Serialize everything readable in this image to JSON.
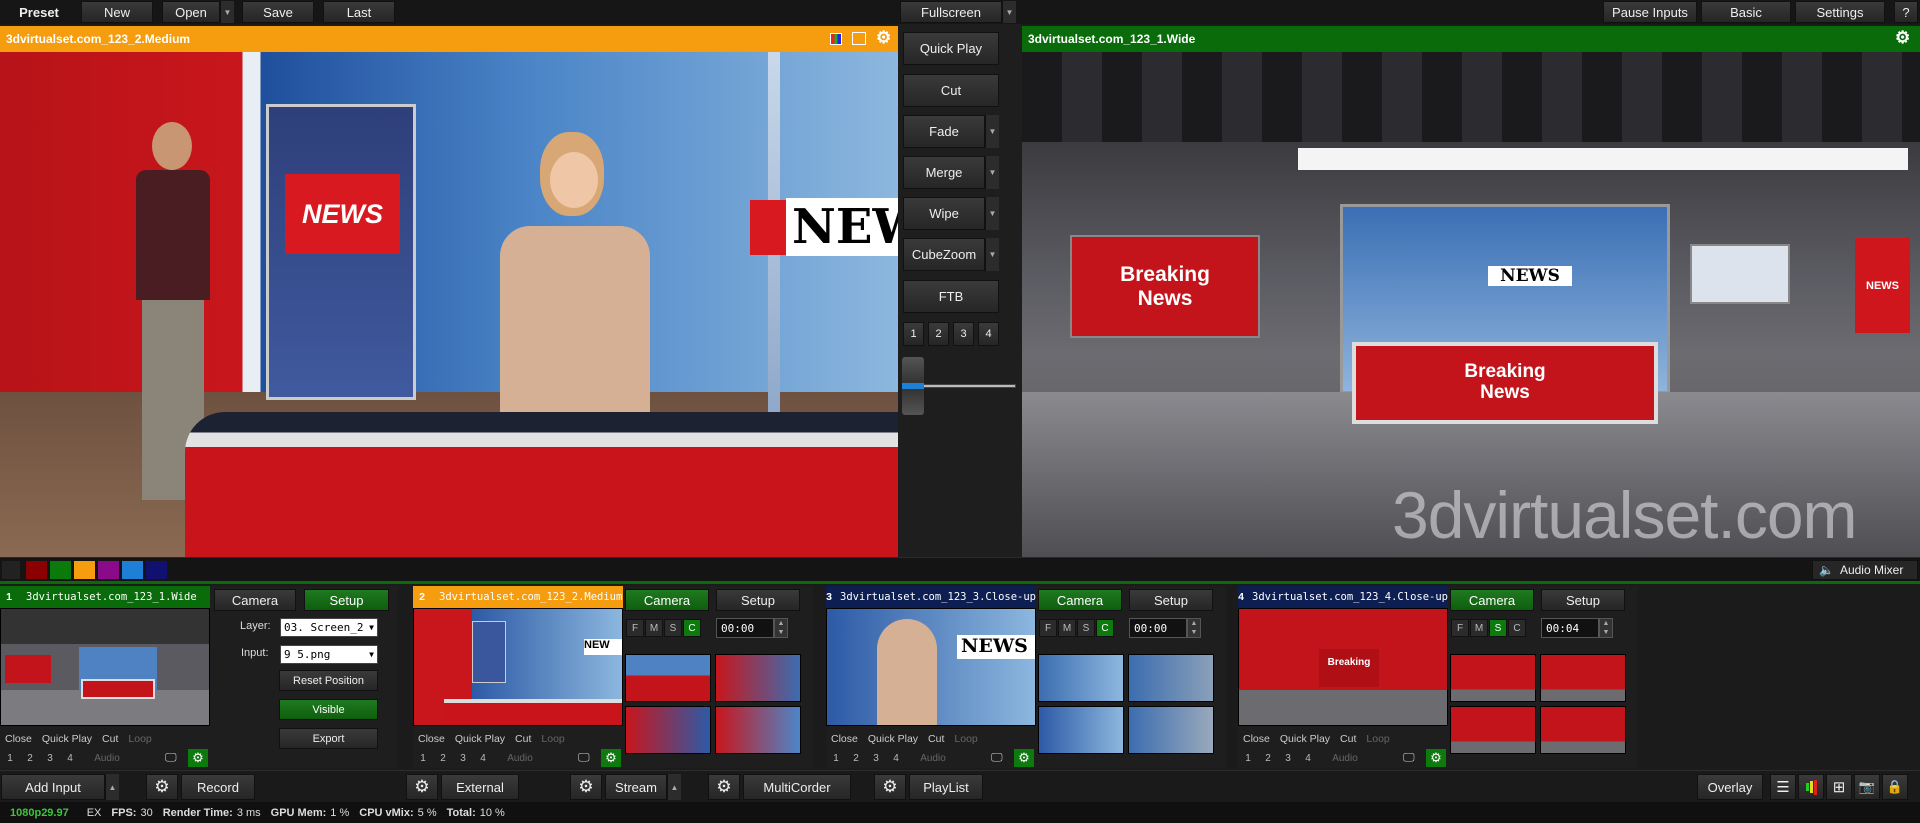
{
  "top_bar": {
    "preset": "Preset",
    "new": "New",
    "open": "Open",
    "save": "Save",
    "last": "Last",
    "fullscreen": "Fullscreen",
    "pause_inputs": "Pause Inputs",
    "basic": "Basic",
    "settings": "Settings",
    "help": "?"
  },
  "preview": {
    "title": "3dvirtualset.com_123_2.Medium",
    "color": "#f59c0f"
  },
  "output": {
    "title": "3dvirtualset.com_123_1.Wide",
    "color": "#0a6b0a"
  },
  "transitions": {
    "quick_play": "Quick Play",
    "cut": "Cut",
    "fade": "Fade",
    "merge": "Merge",
    "wipe": "Wipe",
    "cubezoom": "CubeZoom",
    "ftb": "FTB",
    "numbers": [
      "1",
      "2",
      "3",
      "4"
    ],
    "tbar_position": 0.3
  },
  "color_swatches": [
    "#8b0000",
    "#0a7a0a",
    "#f59c0f",
    "#8a0a8a",
    "#1e7fd6",
    "#101070"
  ],
  "audio_mixer": "Audio Mixer",
  "scene_text": {
    "news": "NEWS",
    "breaking": "Breaking",
    "breaking_news": "News",
    "watermark": "3dvirtualset.com"
  },
  "inputs": [
    {
      "num": "1",
      "name": "3dvirtualset.com_123_1.Wide",
      "color": "#0a6b0a",
      "camera": "Camera",
      "setup": "Setup",
      "layer_label": "Layer:",
      "layer_value": "03. Screen_2",
      "input_label": "Input:",
      "input_value": "9 5.png",
      "reset_position": "Reset Position",
      "visible": "Visible",
      "export": "Export"
    },
    {
      "num": "2",
      "name": "3dvirtualset.com_123_2.Medium",
      "color": "#f59c0f",
      "camera": "Camera",
      "setup": "Setup",
      "fmsc": [
        "F",
        "M",
        "S",
        "C"
      ],
      "active": "C",
      "time": "00:00"
    },
    {
      "num": "3",
      "name": "3dvirtualset.com_123_3.Close-up",
      "color": "#0d1e52",
      "camera": "Camera",
      "setup": "Setup",
      "fmsc": [
        "F",
        "M",
        "S",
        "C"
      ],
      "active": "C",
      "time": "00:00"
    },
    {
      "num": "4",
      "name": "3dvirtualset.com_123_4.Close-up",
      "color": "#0d1e52",
      "camera": "Camera",
      "setup": "Setup",
      "fmsc": [
        "F",
        "M",
        "S",
        "C"
      ],
      "active": "S",
      "time": "00:04"
    }
  ],
  "tile_footer": {
    "close": "Close",
    "quick_play": "Quick Play",
    "cut": "Cut",
    "loop": "Loop",
    "audio": "Audio"
  },
  "bottom_bar": {
    "add_input": "Add Input",
    "record": "Record",
    "external": "External",
    "stream": "Stream",
    "multicorder": "MultiCorder",
    "playlist": "PlayList",
    "overlay": "Overlay"
  },
  "status": {
    "format": "1080p29.97",
    "ex": "EX",
    "fps_label": "FPS:",
    "fps": "30",
    "render_label": "Render Time:",
    "render": "3 ms",
    "gpu_label": "GPU Mem:",
    "gpu": "1 %",
    "cpu_label": "CPU vMix:",
    "cpu": "5 %",
    "total_label": "Total:",
    "total": "10 %"
  }
}
